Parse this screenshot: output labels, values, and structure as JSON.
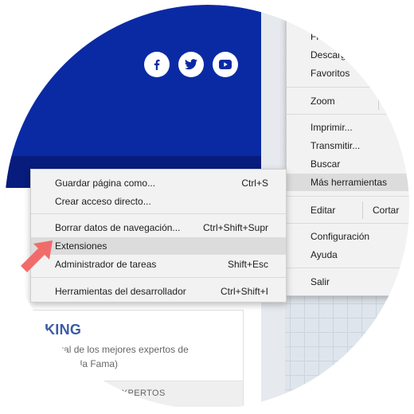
{
  "social": {
    "icons": [
      "facebook-icon",
      "twitter-icon",
      "youtube-icon"
    ],
    "brand_blue": "#0a2aa4"
  },
  "card": {
    "title": "KING",
    "line1": "eneral de los mejores expertos de",
    "line2": "de la Fama)",
    "footer": "EXPERTOS"
  },
  "browser_menu": {
    "items_top": [
      "Fi",
      "Descarg",
      "Favoritos"
    ],
    "zoom_label": "Zoom",
    "items_mid": [
      "Imprimir...",
      "Transmitir...",
      "Buscar",
      "Más herramientas"
    ],
    "edit_label": "Editar",
    "cut_label": "Cortar",
    "items_bottom": [
      "Configuración",
      "Ayuda"
    ],
    "exit_label": "Salir"
  },
  "submenu": {
    "items": [
      {
        "label": "Guardar página como...",
        "shortcut": "Ctrl+S"
      },
      {
        "label": "Crear acceso directo...",
        "shortcut": ""
      },
      {
        "label": "Borrar datos de navegación...",
        "shortcut": "Ctrl+Shift+Supr"
      },
      {
        "label": "Extensiones",
        "shortcut": ""
      },
      {
        "label": "Administrador de tareas",
        "shortcut": "Shift+Esc"
      },
      {
        "label": "Herramientas del desarrollador",
        "shortcut": "Ctrl+Shift+I"
      }
    ],
    "highlight_color": "#dcdcdc"
  },
  "arrow_color": "#f26b6b"
}
